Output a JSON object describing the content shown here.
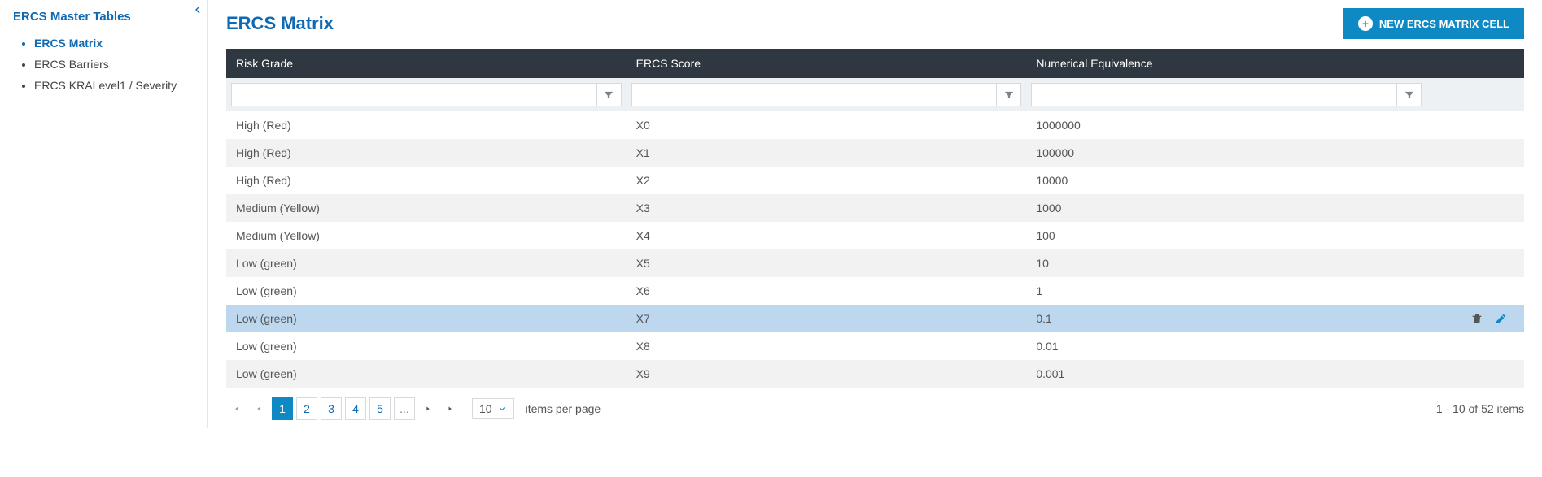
{
  "sidebar": {
    "title": "ERCS Master Tables",
    "items": [
      "ERCS Matrix",
      "ERCS Barriers",
      "ERCS KRALevel1 / Severity"
    ],
    "active_index": 0
  },
  "header": {
    "title": "ERCS Matrix",
    "new_button": "NEW ERCS MATRIX CELL"
  },
  "table": {
    "columns": [
      "Risk Grade",
      "ERCS Score",
      "Numerical Equivalence"
    ],
    "rows": [
      {
        "risk_grade": "High (Red)",
        "ercs_score": "X0",
        "num_eq": "1000000",
        "selected": false
      },
      {
        "risk_grade": "High (Red)",
        "ercs_score": "X1",
        "num_eq": "100000",
        "selected": false
      },
      {
        "risk_grade": "High (Red)",
        "ercs_score": "X2",
        "num_eq": "10000",
        "selected": false
      },
      {
        "risk_grade": "Medium (Yellow)",
        "ercs_score": "X3",
        "num_eq": "1000",
        "selected": false
      },
      {
        "risk_grade": "Medium (Yellow)",
        "ercs_score": "X4",
        "num_eq": "100",
        "selected": false
      },
      {
        "risk_grade": "Low (green)",
        "ercs_score": "X5",
        "num_eq": "10",
        "selected": false
      },
      {
        "risk_grade": "Low (green)",
        "ercs_score": "X6",
        "num_eq": "1",
        "selected": false
      },
      {
        "risk_grade": "Low (green)",
        "ercs_score": "X7",
        "num_eq": "0.1",
        "selected": true
      },
      {
        "risk_grade": "Low (green)",
        "ercs_score": "X8",
        "num_eq": "0.01",
        "selected": false
      },
      {
        "risk_grade": "Low (green)",
        "ercs_score": "X9",
        "num_eq": "0.001",
        "selected": false
      }
    ]
  },
  "pager": {
    "pages": [
      "1",
      "2",
      "3",
      "4",
      "5",
      "..."
    ],
    "active_page": "1",
    "page_size": "10",
    "items_per_page_label": "items per page",
    "summary": "1 - 10 of 52 items"
  }
}
